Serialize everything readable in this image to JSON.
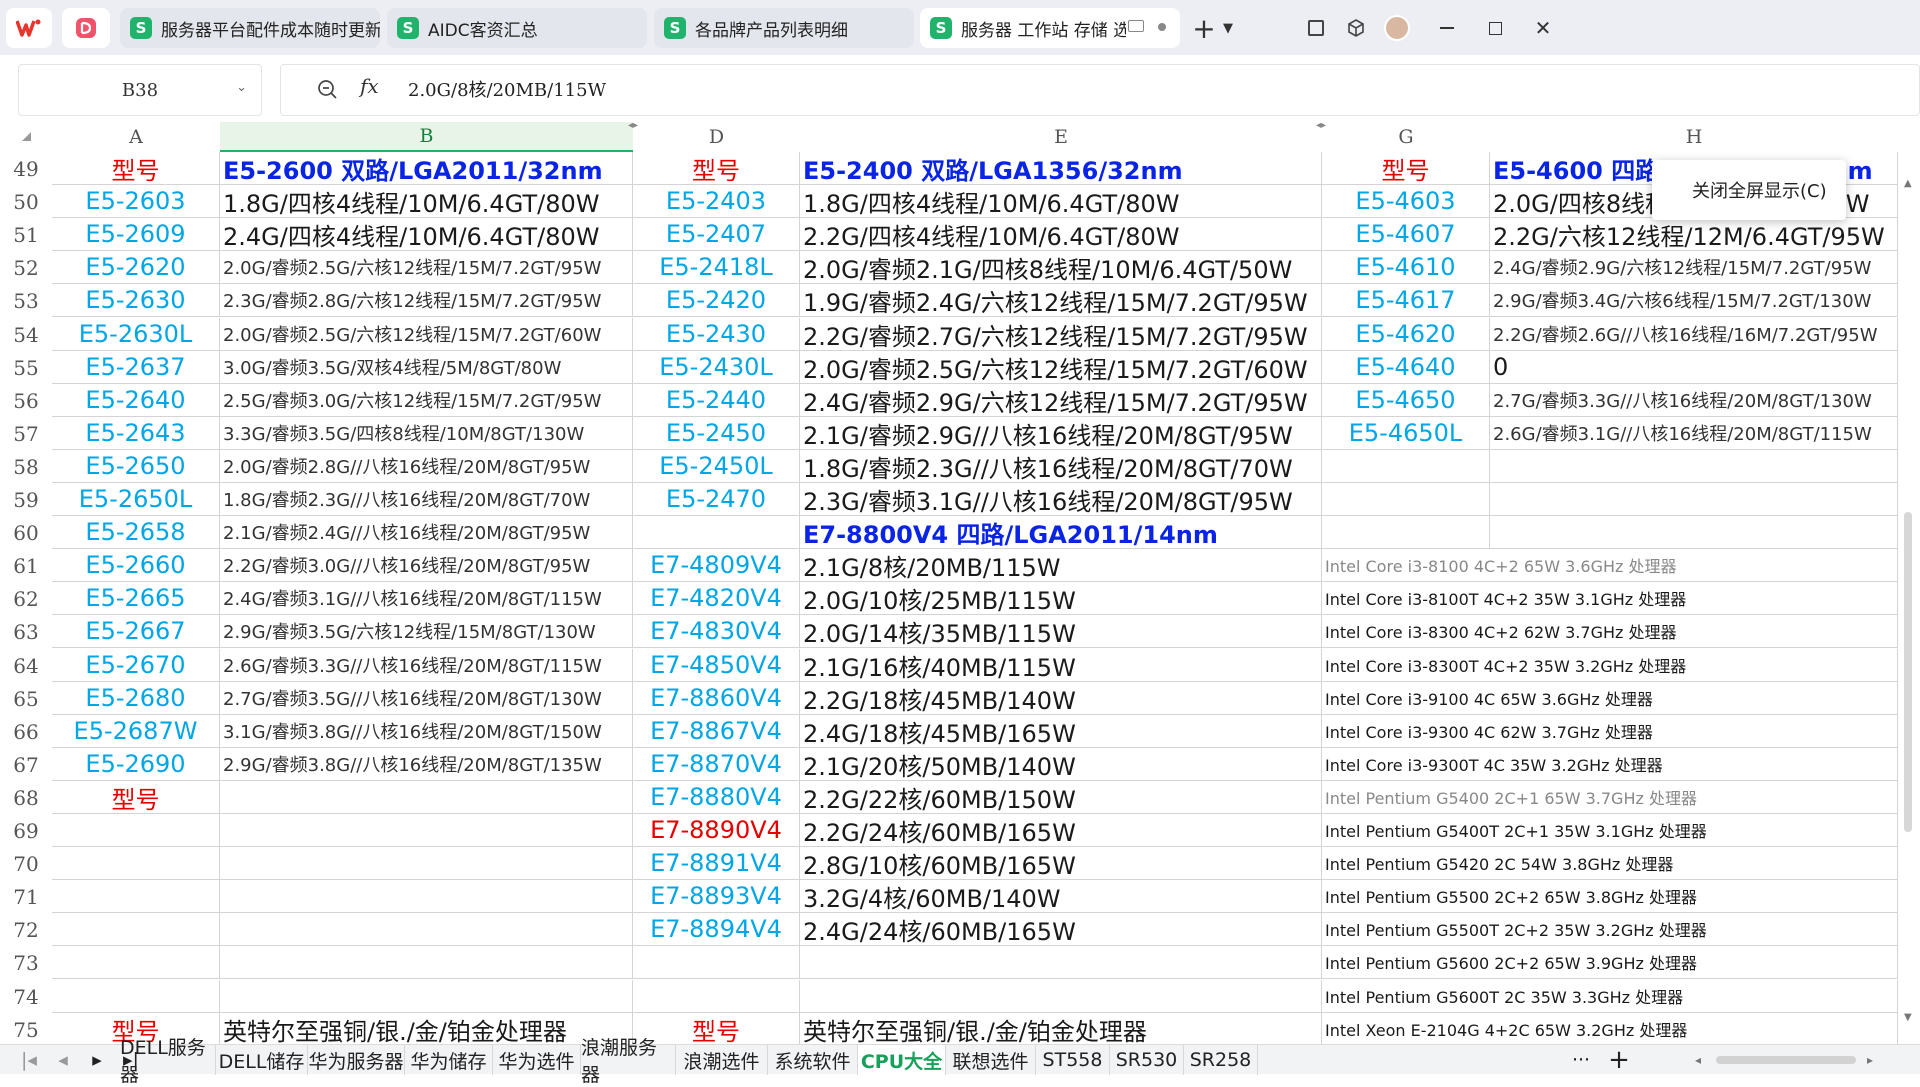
{
  "tabs": [
    {
      "label": "服务器平台配件成本随时更新-SF"
    },
    {
      "label": "AIDC客资汇总"
    },
    {
      "label": "各品牌产品列表明细"
    },
    {
      "label": "服务器 工作站 存储 选件"
    }
  ],
  "app": {
    "brand_icon": "wps-logo-icon",
    "pdf_icon": "pdf-app-icon"
  },
  "formula": {
    "cell_ref": "B38",
    "fx_label": "fx",
    "value": "2.0G/8核/20MB/115W"
  },
  "columns": [
    "A",
    "B",
    "D",
    "E",
    "G",
    "H"
  ],
  "context_menu": {
    "label": "关闭全屏显示(C)"
  },
  "rows": [
    {
      "n": "49",
      "a": "型号",
      "b": "E5-2600 双路/LGA2011/32nm",
      "d": "型号",
      "e": "E5-2400 双路/LGA1356/32nm",
      "g": "型号",
      "h": "E5-4600 四路/LGA2011/32nm"
    },
    {
      "n": "50",
      "a": "E5-2603",
      "b": "1.8G/四核4线程/10M/6.4GT/80W",
      "d": "E5-2403",
      "e": "1.8G/四核4线程/10M/6.4GT/80W",
      "g": "E5-4603",
      "h": "2.0G/四核8线程/10M/6.4GT/95W"
    },
    {
      "n": "51",
      "a": "E5-2609",
      "b": "2.4G/四核4线程/10M/6.4GT/80W",
      "d": "E5-2407",
      "e": "2.2G/四核4线程/10M/6.4GT/80W",
      "g": "E5-4607",
      "h": "2.2G/六核12线程/12M/6.4GT/95W"
    },
    {
      "n": "52",
      "a": "E5-2620",
      "b": "2.0G/睿频2.5G/六核12线程/15M/7.2GT/95W",
      "d": "E5-2418L",
      "e": "2.0G/睿频2.1G/四核8线程/10M/6.4GT/50W",
      "g": "E5-4610",
      "h": "2.4G/睿频2.9G/六核12线程/15M/7.2GT/95W"
    },
    {
      "n": "53",
      "a": "E5-2630",
      "b": "2.3G/睿频2.8G/六核12线程/15M/7.2GT/95W",
      "d": "E5-2420",
      "e": "1.9G/睿频2.4G/六核12线程/15M/7.2GT/95W",
      "g": "E5-4617",
      "h": "2.9G/睿频3.4G/六核6线程/15M/7.2GT/130W"
    },
    {
      "n": "54",
      "a": "E5-2630L",
      "b": "2.0G/睿频2.5G/六核12线程/15M/7.2GT/60W",
      "d": "E5-2430",
      "e": "2.2G/睿频2.7G/六核12线程/15M/7.2GT/95W",
      "g": "E5-4620",
      "h": "2.2G/睿频2.6G//八核16线程/16M/7.2GT/95W"
    },
    {
      "n": "55",
      "a": "E5-2637",
      "b": "3.0G/睿频3.5G/双核4线程/5M/8GT/80W",
      "d": "E5-2430L",
      "e": "2.0G/睿频2.5G/六核12线程/15M/7.2GT/60W",
      "g": "E5-4640",
      "h": "0"
    },
    {
      "n": "56",
      "a": "E5-2640",
      "b": "2.5G/睿频3.0G/六核12线程/15M/7.2GT/95W",
      "d": "E5-2440",
      "e": "2.4G/睿频2.9G/六核12线程/15M/7.2GT/95W",
      "g": "E5-4650",
      "h": "2.7G/睿频3.3G//八核16线程/20M/8GT/130W"
    },
    {
      "n": "57",
      "a": "E5-2643",
      "b": "3.3G/睿频3.5G/四核8线程/10M/8GT/130W",
      "d": "E5-2450",
      "e": "2.1G/睿频2.9G//八核16线程/20M/8GT/95W",
      "g": "E5-4650L",
      "h": "2.6G/睿频3.1G//八核16线程/20M/8GT/115W"
    },
    {
      "n": "58",
      "a": "E5-2650",
      "b": "2.0G/睿频2.8G//八核16线程/20M/8GT/95W",
      "d": "E5-2450L",
      "e": "1.8G/睿频2.3G//八核16线程/20M/8GT/70W",
      "g": "",
      "h": ""
    },
    {
      "n": "59",
      "a": "E5-2650L",
      "b": "1.8G/睿频2.3G//八核16线程/20M/8GT/70W",
      "d": "E5-2470",
      "e": "2.3G/睿频3.1G//八核16线程/20M/8GT/95W",
      "g": "",
      "h": ""
    },
    {
      "n": "60",
      "a": "E5-2658",
      "b": "2.1G/睿频2.4G//八核16线程/20M/8GT/95W",
      "d": "",
      "e": "E7-8800V4 四路/LGA2011/14nm",
      "g": "",
      "h": ""
    },
    {
      "n": "61",
      "a": "E5-2660",
      "b": "2.2G/睿频3.0G//八核16线程/20M/8GT/95W",
      "d": "E7-4809V4",
      "e": "2.1G/8核/20MB/115W",
      "g": "Intel Core i3-8100 4C+2 65W 3.6GHz 处理器",
      "h": ""
    },
    {
      "n": "62",
      "a": "E5-2665",
      "b": "2.4G/睿频3.1G//八核16线程/20M/8GT/115W",
      "d": "E7-4820V4",
      "e": "2.0G/10核/25MB/115W",
      "g": "Intel Core i3-8100T 4C+2 35W 3.1GHz 处理器",
      "h": ""
    },
    {
      "n": "63",
      "a": "E5-2667",
      "b": "2.9G/睿频3.5G/六核12线程/15M/8GT/130W",
      "d": "E7-4830V4",
      "e": "2.0G/14核/35MB/115W",
      "g": "Intel Core i3-8300 4C+2 62W 3.7GHz 处理器",
      "h": ""
    },
    {
      "n": "64",
      "a": "E5-2670",
      "b": "2.6G/睿频3.3G//八核16线程/20M/8GT/115W",
      "d": "E7-4850V4",
      "e": "2.1G/16核/40MB/115W",
      "g": "Intel Core i3-8300T 4C+2 35W 3.2GHz 处理器",
      "h": ""
    },
    {
      "n": "65",
      "a": "E5-2680",
      "b": "2.7G/睿频3.5G//八核16线程/20M/8GT/130W",
      "d": "E7-8860V4",
      "e": "2.2G/18核/45MB/140W",
      "g": "Intel Core i3-9100 4C 65W 3.6GHz 处理器",
      "h": ""
    },
    {
      "n": "66",
      "a": "E5-2687W",
      "b": "3.1G/睿频3.8G//八核16线程/20M/8GT/150W",
      "d": "E7-8867V4",
      "e": "2.4G/18核/45MB/165W",
      "g": "Intel Core i3-9300 4C 62W 3.7GHz 处理器",
      "h": ""
    },
    {
      "n": "67",
      "a": "E5-2690",
      "b": "2.9G/睿频3.8G//八核16线程/20M/8GT/135W",
      "d": "E7-8870V4",
      "e": "2.1G/20核/50MB/140W",
      "g": "Intel Core i3-9300T 4C 35W 3.2GHz 处理器",
      "h": ""
    },
    {
      "n": "68",
      "a": "型号",
      "b": "",
      "d": "E7-8880V4",
      "e": "2.2G/22核/60MB/150W",
      "g": "Intel Pentium G5400 2C+1 65W 3.7GHz 处理器",
      "h": ""
    },
    {
      "n": "69",
      "a": "",
      "b": "",
      "d": "E7-8890V4",
      "e": "2.2G/24核/60MB/165W",
      "g": "Intel Pentium G5400T 2C+1 35W 3.1GHz 处理器",
      "h": ""
    },
    {
      "n": "70",
      "a": "",
      "b": "",
      "d": "E7-8891V4",
      "e": "2.8G/10核/60MB/165W",
      "g": "Intel Pentium G5420 2C 54W 3.8GHz 处理器",
      "h": ""
    },
    {
      "n": "71",
      "a": "",
      "b": "",
      "d": "E7-8893V4",
      "e": "3.2G/4核/60MB/140W",
      "g": "Intel Pentium G5500 2C+2 65W 3.8GHz 处理器",
      "h": ""
    },
    {
      "n": "72",
      "a": "",
      "b": "",
      "d": "E7-8894V4",
      "e": "2.4G/24核/60MB/165W",
      "g": "Intel Pentium G5500T 2C+2 35W 3.2GHz 处理器",
      "h": ""
    },
    {
      "n": "73",
      "a": "",
      "b": "",
      "d": "",
      "e": "",
      "g": "Intel Pentium G5600 2C+2 65W 3.9GHz 处理器",
      "h": ""
    },
    {
      "n": "74",
      "a": "",
      "b": "",
      "d": "",
      "e": "",
      "g": "Intel Pentium G5600T 2C 35W 3.3GHz 处理器",
      "h": ""
    },
    {
      "n": "75",
      "a": "型号",
      "b": "英特尔至强铜/银./金/铂金处理器",
      "d": "型号",
      "e": "英特尔至强铜/银./金/铂金处理器",
      "g": "Intel Xeon E-2104G 4+2C 65W 3.2GHz 处理器",
      "h": ""
    }
  ],
  "sheets": [
    "DELL服务器",
    "DELL储存",
    "华为服务器",
    "华为储存",
    "华为选件",
    "浪潮服务器",
    "浪潮选件",
    "系统软件",
    "CPU大全",
    "联想选件",
    "ST558",
    "SR530",
    "SR258"
  ],
  "active_sheet": "CPU大全",
  "sheets_more": "···",
  "sheets_add": "+"
}
